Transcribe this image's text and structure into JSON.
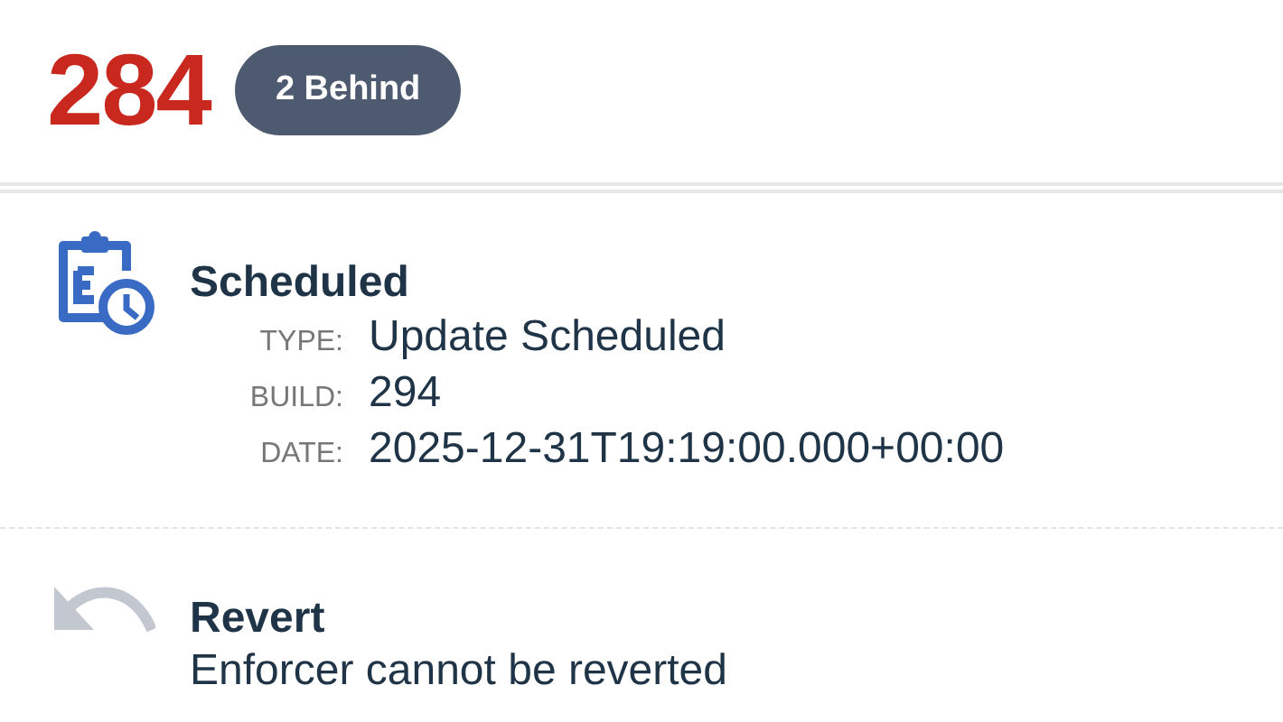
{
  "header": {
    "build_number": "284",
    "status_badge": "2 Behind"
  },
  "sections": [
    {
      "kind": "schedule",
      "title": "Scheduled",
      "disabled": false,
      "fields": [
        {
          "label": "TYPE:",
          "value": "Update Scheduled"
        },
        {
          "label": "BUILD:",
          "value": "294"
        },
        {
          "label": "DATE:",
          "value": "2025-12-31T19:19:00.000+00:00"
        }
      ]
    },
    {
      "kind": "revert",
      "title": "Revert",
      "disabled": true,
      "description": "Enforcer cannot be reverted"
    }
  ]
}
